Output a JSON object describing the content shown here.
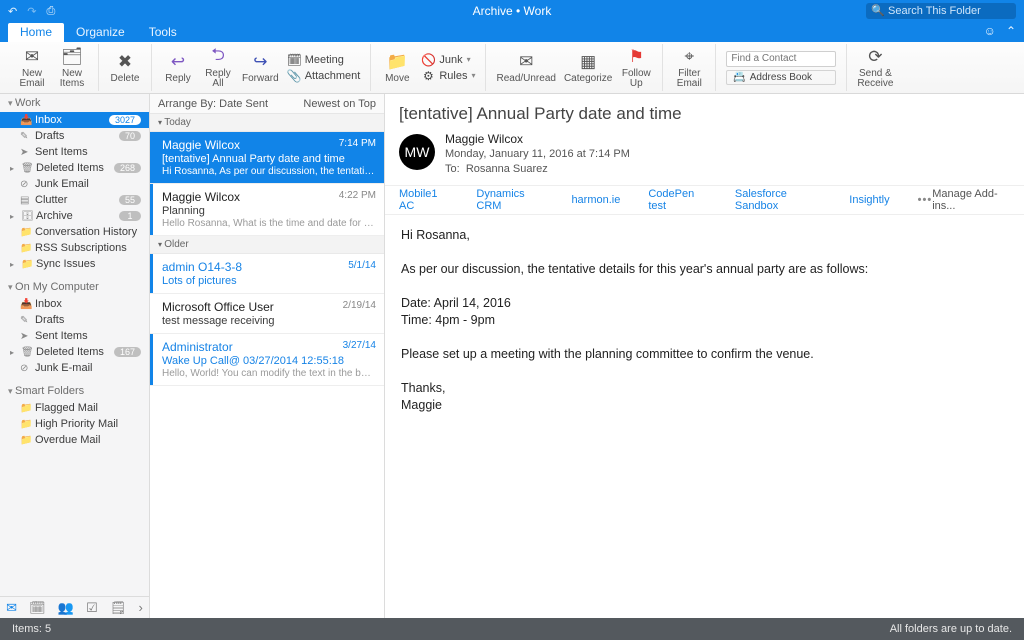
{
  "window": {
    "title": "Archive • Work",
    "search_placeholder": "Search This Folder"
  },
  "tabs": {
    "home": "Home",
    "organize": "Organize",
    "tools": "Tools"
  },
  "ribbon": {
    "new_email": "New\nEmail",
    "new_items": "New\nItems",
    "delete": "Delete",
    "reply": "Reply",
    "reply_all": "Reply\nAll",
    "forward": "Forward",
    "meeting": "Meeting",
    "attachment": "Attachment",
    "move": "Move",
    "junk": "Junk",
    "rules": "Rules",
    "read_unread": "Read/Unread",
    "categorize": "Categorize",
    "follow_up": "Follow\nUp",
    "filter_email": "Filter\nEmail",
    "find_contact_placeholder": "Find a Contact",
    "address_book": "Address Book",
    "send_receive": "Send &\nReceive"
  },
  "folders": {
    "work": "Work",
    "inbox": "Inbox",
    "inbox_badge": "3027",
    "drafts": "Drafts",
    "drafts_badge": "70",
    "sent": "Sent Items",
    "deleted": "Deleted Items",
    "deleted_badge": "268",
    "junk": "Junk Email",
    "clutter": "Clutter",
    "clutter_badge": "55",
    "archive": "Archive",
    "archive_badge": "1",
    "conv": "Conversation History",
    "rss": "RSS Subscriptions",
    "sync": "Sync Issues",
    "onmy": "On My Computer",
    "inbox2": "Inbox",
    "drafts2": "Drafts",
    "sent2": "Sent Items",
    "deleted2": "Deleted Items",
    "deleted2_badge": "167",
    "junk2": "Junk E-mail",
    "smart": "Smart Folders",
    "flagged": "Flagged Mail",
    "highpri": "High Priority Mail",
    "overdue": "Overdue Mail"
  },
  "arrange": {
    "by": "Arrange By: Date Sent",
    "order": "Newest on Top"
  },
  "groups": {
    "today": "Today",
    "older": "Older"
  },
  "messages": {
    "m1": {
      "from": "Maggie Wilcox",
      "subj": "[tentative] Annual Party date and time",
      "time": "7:14 PM",
      "preview": "Hi Rosanna, As per our discussion, the tentative detail…"
    },
    "m2": {
      "from": "Maggie Wilcox",
      "subj": "Planning",
      "time": "4:22 PM",
      "preview": "Hello Rosanna, What is the time and date for the holid…"
    },
    "m3": {
      "from": "admin O14-3-8",
      "subj": "Lots of pictures",
      "time": "5/1/14",
      "preview": ""
    },
    "m4": {
      "from": "Microsoft Office User",
      "subj": "test message receiving",
      "time": "2/19/14",
      "preview": ""
    },
    "m5": {
      "from": "Administrator",
      "subj": "Wake Up Call@ 03/27/2014 12:55:18",
      "time": "3/27/14",
      "preview": "Hello, World! You can modify the text in the box to the…"
    }
  },
  "reading": {
    "subject": "[tentative] Annual Party date and time",
    "initials": "MW",
    "sender": "Maggie Wilcox",
    "date": "Monday, January 11, 2016 at 7:14 PM",
    "to_label": "To:",
    "to_value": "Rosanna Suarez",
    "addins": {
      "a1": "Mobile1 AC",
      "a2": "Dynamics CRM",
      "a3": "harmon.ie",
      "a4": "CodePen test",
      "a5": "Salesforce Sandbox",
      "a6": "Insightly",
      "manage": "Manage Add-ins..."
    },
    "body": "Hi Rosanna,\n\nAs per our discussion, the tentative details for this year's annual party are as follows:\n\nDate: April 14, 2016\nTime: 4pm - 9pm\n\nPlease set up a meeting with the planning committee to confirm the venue.\n\nThanks,\nMaggie"
  },
  "status": {
    "items": "Items: 5",
    "sync": "All folders are up to date."
  }
}
